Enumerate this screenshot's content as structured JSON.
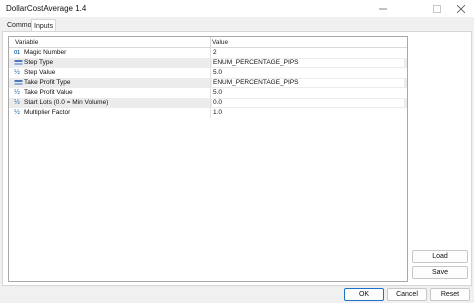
{
  "window": {
    "title": "DollarCostAverage 1.4"
  },
  "tabs": [
    {
      "label": "Common"
    },
    {
      "label": "Inputs",
      "active": true
    }
  ],
  "grid": {
    "columns": {
      "variable": "Variable",
      "value": "Value"
    },
    "rows": [
      {
        "icon": "01",
        "icon_kind": "integer-icon",
        "variable": "Magic Number",
        "value": "2"
      },
      {
        "icon": "enum",
        "icon_kind": "enum-icon",
        "variable": "Step Type",
        "value": "ENUM_PERCENTAGE_PIPS"
      },
      {
        "icon": "½",
        "icon_kind": "double-icon",
        "variable": "Step Value",
        "value": "5.0"
      },
      {
        "icon": "enum",
        "icon_kind": "enum-icon",
        "variable": "Take Profit Type",
        "value": "ENUM_PERCENTAGE_PIPS"
      },
      {
        "icon": "½",
        "icon_kind": "double-icon",
        "variable": "Take Profit Value",
        "value": "5.0"
      },
      {
        "icon": "½",
        "icon_kind": "double-icon",
        "variable": "Start Lots (0.0 = Min Volume)",
        "value": "0.0"
      },
      {
        "icon": "½",
        "icon_kind": "double-icon",
        "variable": "Multiplier Factor",
        "value": "1.0"
      }
    ]
  },
  "side_buttons": {
    "load_label": "Load",
    "save_label": "Save"
  },
  "bottom_buttons": {
    "ok_label": "OK",
    "cancel_label": "Cancel",
    "reset_label": "Reset"
  },
  "colors": {
    "alt_row": "#ececec",
    "primary_border": "#1a73c8",
    "integer_icon": "#2a6fb0",
    "double_icon": "#2a6fb0",
    "enum_icon": "#4a78b8"
  }
}
